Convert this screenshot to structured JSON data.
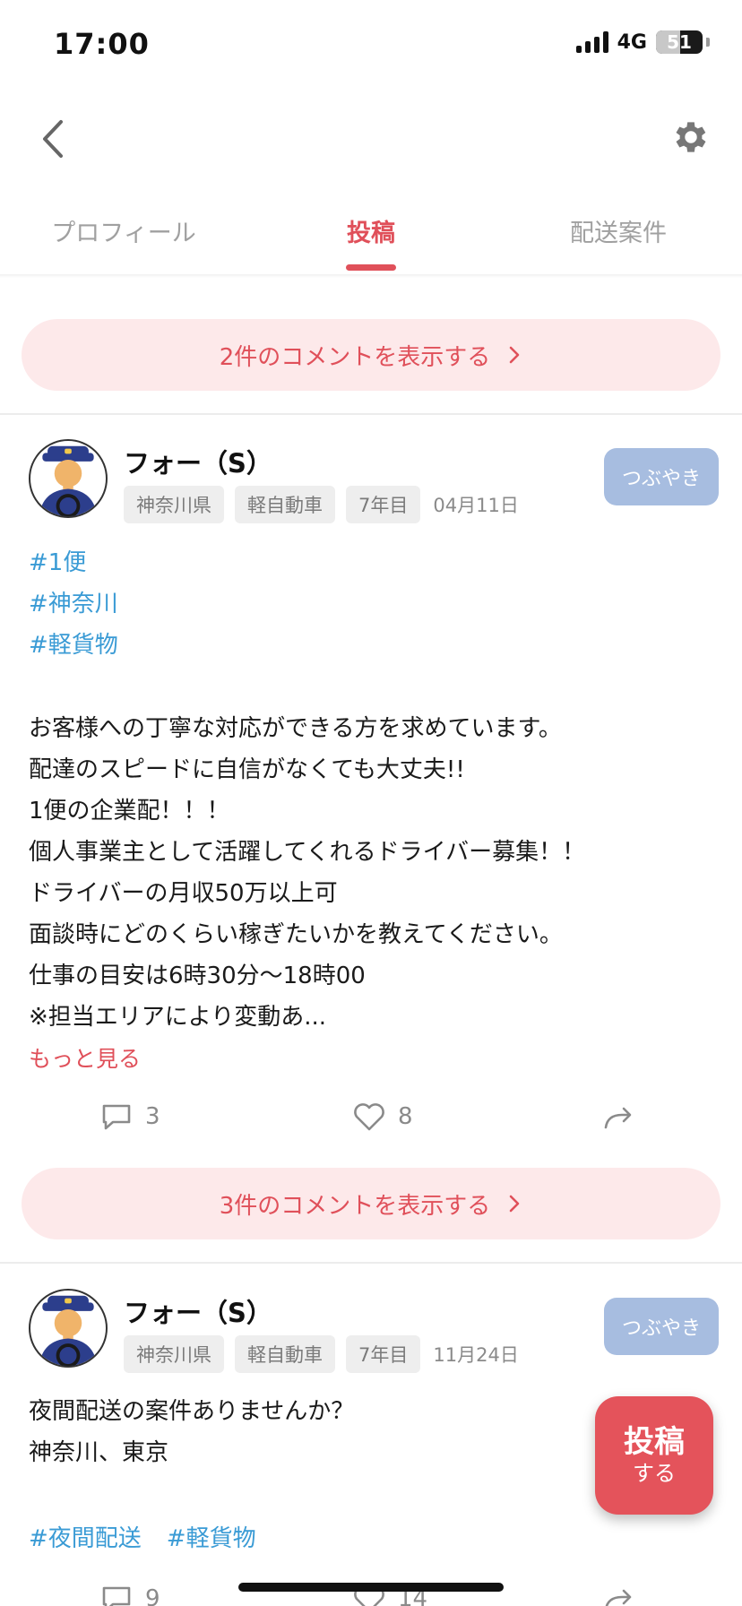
{
  "status_bar": {
    "time": "17:00",
    "network": "4G",
    "battery": "51",
    "battery_level": 0.51
  },
  "tabs": [
    {
      "label": "プロフィール",
      "active": false
    },
    {
      "label": "投稿",
      "active": true
    },
    {
      "label": "配送案件",
      "active": false
    }
  ],
  "top_comments": {
    "label": "2件のコメントを表示する"
  },
  "posts": [
    {
      "author": "フォー（S）",
      "tags": [
        "神奈川県",
        "軽自動車",
        "7年目"
      ],
      "date": "04月11日",
      "type_label": "つぶやき",
      "hashtags": [
        "#1便",
        "#神奈川",
        "#軽貨物"
      ],
      "body": [
        "お客様への丁寧な対応ができる方を求めています。",
        "配達のスピードに自信がなくても大丈夫!!",
        "1便の企業配！！！",
        "個人事業主として活躍してくれるドライバー募集！！",
        "ドライバーの月収50万以上可",
        "面談時にどのくらい稼ぎたいかを教えてください。",
        "仕事の目安は6時30分～18時00",
        "※担当エリアにより変動あ..."
      ],
      "more_label": "もっと見る",
      "comment_count": "3",
      "like_count": "8",
      "comments_button": "3件のコメントを表示する"
    },
    {
      "author": "フォー（S）",
      "tags": [
        "神奈川県",
        "軽自動車",
        "7年目"
      ],
      "date": "11月24日",
      "type_label": "つぶやき",
      "body": [
        "夜間配送の案件ありませんか？",
        "神奈川、東京"
      ],
      "hashtags": [
        "#夜間配送",
        "#軽貨物"
      ],
      "comment_count": "9",
      "like_count": "14"
    }
  ],
  "fab": {
    "line1": "投稿",
    "line2": "する"
  },
  "colors": {
    "accent": "#e0505a",
    "hashtag": "#3a9bd5",
    "chip_bg": "#eeeeee",
    "type_btn": "#a7bde0",
    "comment_bg": "#fde9ea"
  }
}
